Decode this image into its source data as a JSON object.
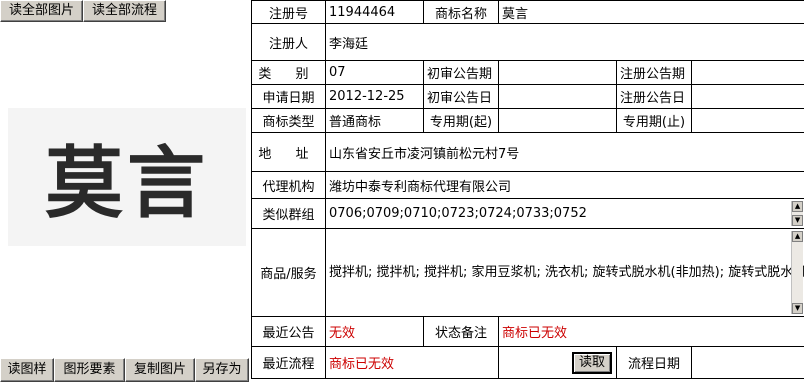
{
  "top_buttons": {
    "read_all_images": "读全部图片",
    "read_all_flows": "读全部流程"
  },
  "trademark": {
    "image_text": "莫言"
  },
  "bottom_buttons": {
    "read_sample": "读图样",
    "graphic_elements": "图形要素",
    "copy_image": "复制图片",
    "save_as": "另存为"
  },
  "labels": {
    "reg_no": "注册号",
    "tm_name": "商标名称",
    "registrant": "注册人",
    "category": "类 别",
    "prelim_pub_no": "初审公告期",
    "reg_pub_no": "注册公告期",
    "apply_date": "申请日期",
    "prelim_pub_date": "初审公告日",
    "reg_pub_date": "注册公告日",
    "tm_type": "商标类型",
    "exclusive_start": "专用期(起)",
    "exclusive_end": "专用期(止)",
    "address": "地 址",
    "agency": "代理机构",
    "similar_groups": "类似群组",
    "goods_services": "商品/服务",
    "latest_notice": "最近公告",
    "status_note": "状态备注",
    "latest_flow": "最近流程",
    "flow_date": "流程日期"
  },
  "values": {
    "reg_no": "11944464",
    "tm_name": "莫言",
    "registrant": "李海廷",
    "category": "07",
    "prelim_pub_no": "",
    "reg_pub_no": "",
    "apply_date": "2012-12-25",
    "prelim_pub_date": "",
    "reg_pub_date": "",
    "tm_type": "普通商标",
    "exclusive_start": "",
    "exclusive_end": "",
    "address": "山东省安丘市凌河镇前松元村7号",
    "agency": "潍坊中泰专利商标代理有限公司",
    "similar_groups": "0706;0709;0710;0723;0724;0733;0752",
    "goods_services": "搅拌机; 搅拌机; 搅拌机; 家用豆浆机; 洗衣机; 旋转式脱水机(非加热); 旋转式脱水机(非加热); 制矿泉水机械; 真空吸尘器; 食品包装机; 厨房用电动机器; 家用切肉机; 馒头机",
    "latest_notice": "无效",
    "status_note": "商标已无效",
    "latest_flow": "商标已无效",
    "flow_date": ""
  },
  "read_button": "读取",
  "colors": {
    "button_face": "#d4d0c8",
    "status_red": "#cc0000"
  }
}
